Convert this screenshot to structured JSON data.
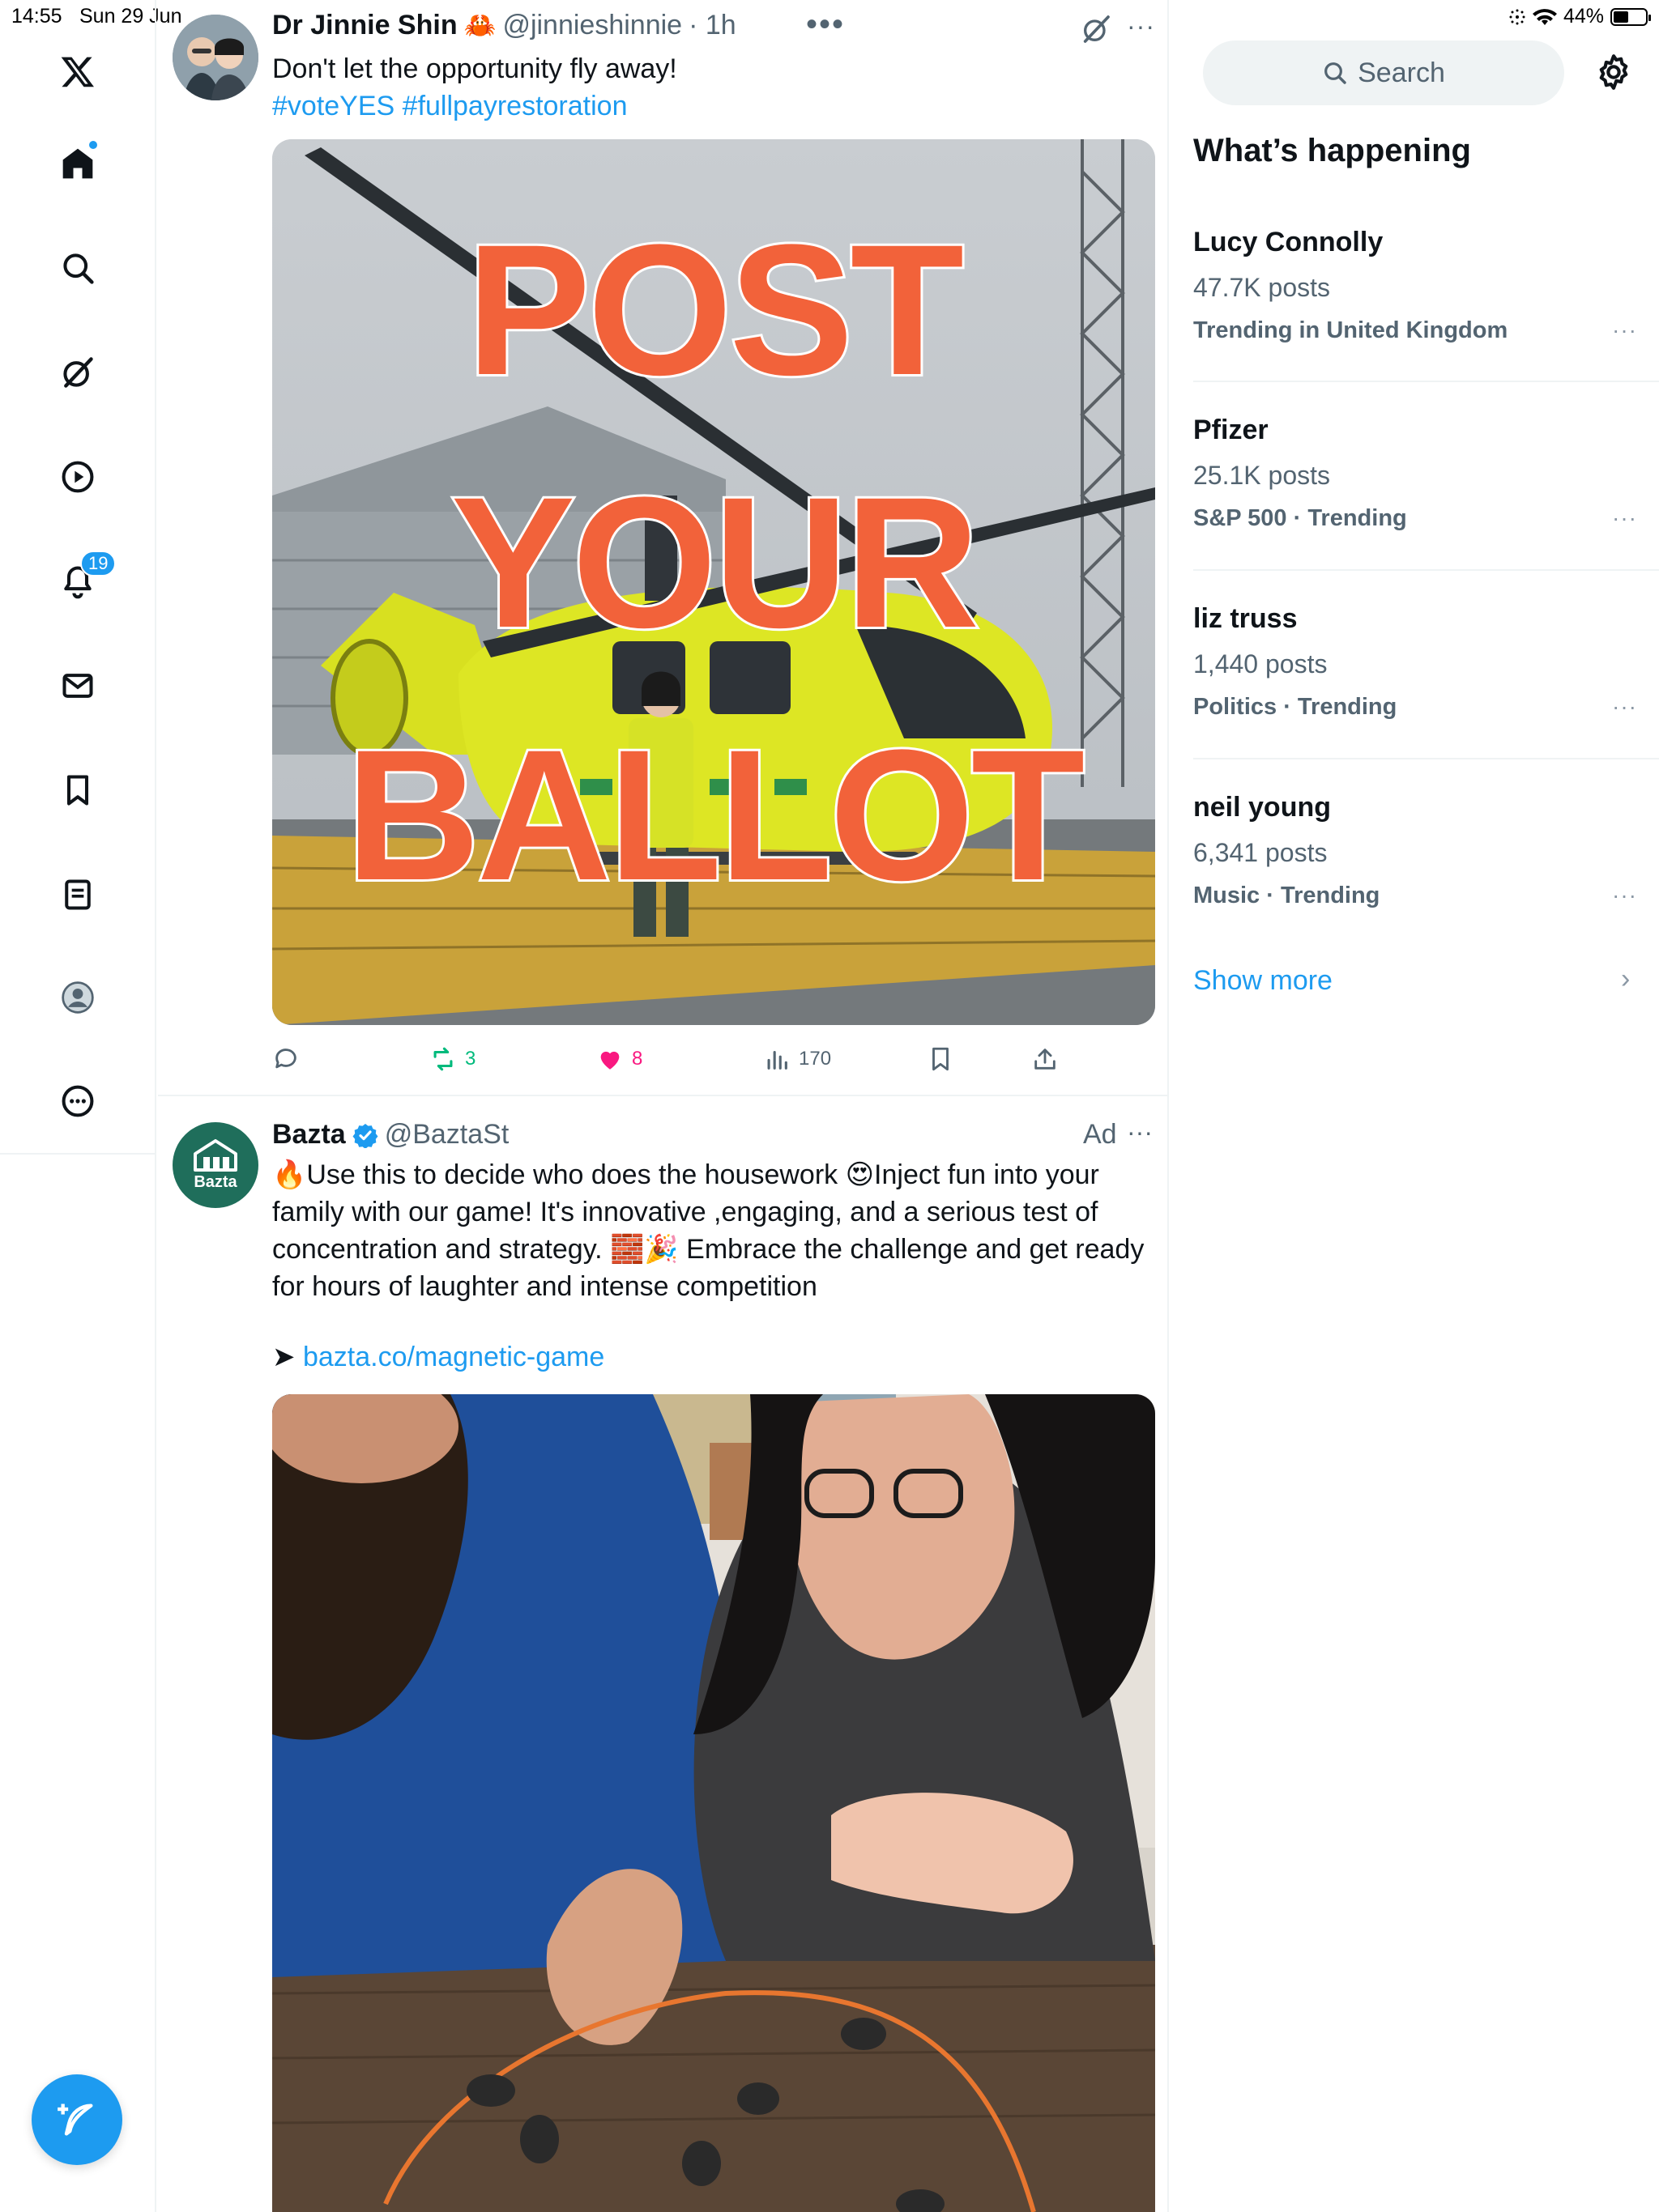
{
  "status_bar": {
    "time": "14:55",
    "date": "Sun 29 Jun",
    "battery": "44%"
  },
  "nav": {
    "items": [
      "Home",
      "Explore",
      "Grok",
      "Videos",
      "Notifications",
      "Messages",
      "Bookmarks",
      "Lists",
      "Profile",
      "More"
    ],
    "notifications_badge": "19"
  },
  "tweet1": {
    "name": "Dr Jinnie Shin",
    "emoji": "🦀",
    "handle": "@jinnieshinnie",
    "time": "· 1h",
    "text": "Don't let the opportunity fly away!",
    "hashtags": "#voteYES #fullpayrestoration",
    "image_text": [
      "POST",
      "YOUR",
      "BALLOT"
    ],
    "replies": "",
    "reposts": "3",
    "likes": "8",
    "views": "170"
  },
  "tweet2": {
    "name": "Bazta",
    "handle": "@BaztaSt",
    "ad_label": "Ad",
    "avatar_label": "Bazta",
    "lines": [
      "🔥Use this to decide who does the housework 😍Inject fun into your",
      "family with our game! It's innovative ,engaging, and a serious test of",
      "concentration and strategy. 🧱🎉 Embrace the challenge and get ready",
      "for hours of laughter and intense competition"
    ],
    "link_arrow": "➤",
    "link": "bazta.co/magnetic-game"
  },
  "sidebar": {
    "search_placeholder": "Search",
    "title": "What’s happening",
    "trends": [
      {
        "name": "Lucy Connolly",
        "posts": "47.7K posts",
        "context": "Trending in United Kingdom"
      },
      {
        "name": "Pfizer",
        "posts": "25.1K posts",
        "context": "S&P 500 · Trending"
      },
      {
        "name": "liz truss",
        "posts": "1,440 posts",
        "context": "Politics · Trending"
      },
      {
        "name": "neil young",
        "posts": "6,341 posts",
        "context": "Music · Trending"
      }
    ],
    "show_more": "Show more"
  },
  "colors": {
    "accent": "#1d9bf0",
    "like": "#f91880",
    "repost": "#00ba7c",
    "overlay": "#f2623a"
  }
}
